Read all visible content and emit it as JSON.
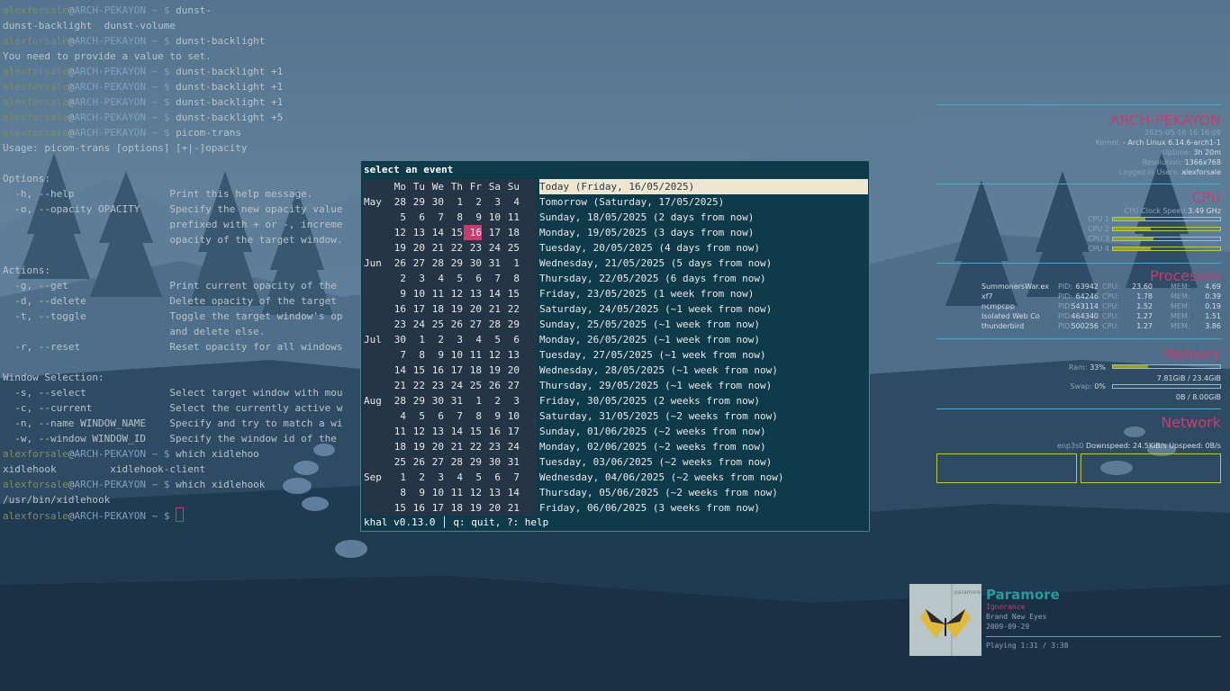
{
  "terminal": {
    "user": "alexforsale",
    "host": "ARCH-PEKAYON",
    "path": "~",
    "prompt": "$",
    "lines": [
      {
        "type": "prompt",
        "cmd": "dunst-"
      },
      {
        "type": "out",
        "text": "dunst-backlight  dunst-volume"
      },
      {
        "type": "prompt",
        "cmd": "dunst-backlight"
      },
      {
        "type": "out",
        "text": "You need to provide a value to set."
      },
      {
        "type": "prompt",
        "cmd": "dunst-backlight +1"
      },
      {
        "type": "prompt",
        "cmd": "dunst-backlight +1"
      },
      {
        "type": "prompt",
        "cmd": "dunst-backlight +1"
      },
      {
        "type": "prompt",
        "cmd": "dunst-backlight +5"
      },
      {
        "type": "prompt",
        "cmd": "picom-trans"
      },
      {
        "type": "out",
        "text": "Usage: picom-trans [options] [+|-]opacity"
      },
      {
        "type": "out",
        "text": ""
      },
      {
        "type": "out",
        "text": "Options:"
      },
      {
        "type": "out",
        "text": "  -h, --help                Print this help message."
      },
      {
        "type": "out",
        "text": "  -o, --opacity OPACITY     Specify the new opacity value"
      },
      {
        "type": "out",
        "text": "                            prefixed with + or -, increme"
      },
      {
        "type": "out",
        "text": "                            opacity of the target window."
      },
      {
        "type": "out",
        "text": ""
      },
      {
        "type": "out",
        "text": "Actions:"
      },
      {
        "type": "out",
        "text": "  -g, --get                 Print current opacity of the"
      },
      {
        "type": "out",
        "text": "  -d, --delete              Delete opacity of the target"
      },
      {
        "type": "out",
        "text": "  -t, --toggle              Toggle the target window's op"
      },
      {
        "type": "out",
        "text": "                            and delete else."
      },
      {
        "type": "out",
        "text": "  -r, --reset               Reset opacity for all windows"
      },
      {
        "type": "out",
        "text": ""
      },
      {
        "type": "out",
        "text": "Window Selection:"
      },
      {
        "type": "out",
        "text": "  -s, --select              Select target window with mou"
      },
      {
        "type": "out",
        "text": "  -c, --current             Select the currently active w"
      },
      {
        "type": "out",
        "text": "  -n, --name WINDOW_NAME    Specify and try to match a wi"
      },
      {
        "type": "out",
        "text": "  -w, --window WINDOW_ID    Specify the window id of the"
      },
      {
        "type": "prompt",
        "cmd": "which xidlehoo"
      },
      {
        "type": "out",
        "text": "xidlehook         xidlehook-client"
      },
      {
        "type": "prompt",
        "cmd": "which xidlehook"
      },
      {
        "type": "out",
        "text": "/usr/bin/xidlehook"
      },
      {
        "type": "prompt",
        "cmd": "",
        "cursor": true
      }
    ]
  },
  "khal": {
    "title": "select an event",
    "weekdays": [
      "Mo",
      "Tu",
      "We",
      "Th",
      "Fr",
      "Sa",
      "Su"
    ],
    "weeks": [
      {
        "month": "May",
        "days": [
          "28",
          "29",
          "30",
          "1",
          "2",
          "3",
          "4"
        ]
      },
      {
        "month": "",
        "days": [
          "5",
          "6",
          "7",
          "8",
          "9",
          "10",
          "11"
        ]
      },
      {
        "month": "",
        "days": [
          "12",
          "13",
          "14",
          "15",
          "16",
          "17",
          "18"
        ],
        "today_index": 4
      },
      {
        "month": "",
        "days": [
          "19",
          "20",
          "21",
          "22",
          "23",
          "24",
          "25"
        ]
      },
      {
        "month": "Jun",
        "days": [
          "26",
          "27",
          "28",
          "29",
          "30",
          "31",
          "1"
        ]
      },
      {
        "month": "",
        "days": [
          "2",
          "3",
          "4",
          "5",
          "6",
          "7",
          "8"
        ]
      },
      {
        "month": "",
        "days": [
          "9",
          "10",
          "11",
          "12",
          "13",
          "14",
          "15"
        ]
      },
      {
        "month": "",
        "days": [
          "16",
          "17",
          "18",
          "19",
          "20",
          "21",
          "22"
        ]
      },
      {
        "month": "",
        "days": [
          "23",
          "24",
          "25",
          "26",
          "27",
          "28",
          "29"
        ]
      },
      {
        "month": "Jul",
        "days": [
          "30",
          "1",
          "2",
          "3",
          "4",
          "5",
          "6"
        ]
      },
      {
        "month": "",
        "days": [
          "7",
          "8",
          "9",
          "10",
          "11",
          "12",
          "13"
        ]
      },
      {
        "month": "",
        "days": [
          "14",
          "15",
          "16",
          "17",
          "18",
          "19",
          "20"
        ]
      },
      {
        "month": "",
        "days": [
          "21",
          "22",
          "23",
          "24",
          "25",
          "26",
          "27"
        ]
      },
      {
        "month": "Aug",
        "days": [
          "28",
          "29",
          "30",
          "31",
          "1",
          "2",
          "3"
        ]
      },
      {
        "month": "",
        "days": [
          "4",
          "5",
          "6",
          "7",
          "8",
          "9",
          "10"
        ]
      },
      {
        "month": "",
        "days": [
          "11",
          "12",
          "13",
          "14",
          "15",
          "16",
          "17"
        ]
      },
      {
        "month": "",
        "days": [
          "18",
          "19",
          "20",
          "21",
          "22",
          "23",
          "24"
        ]
      },
      {
        "month": "",
        "days": [
          "25",
          "26",
          "27",
          "28",
          "29",
          "30",
          "31"
        ]
      },
      {
        "month": "Sep",
        "days": [
          "1",
          "2",
          "3",
          "4",
          "5",
          "6",
          "7"
        ]
      },
      {
        "month": "",
        "days": [
          "8",
          "9",
          "10",
          "11",
          "12",
          "13",
          "14"
        ]
      },
      {
        "month": "",
        "days": [
          "15",
          "16",
          "17",
          "18",
          "19",
          "20",
          "21"
        ]
      }
    ],
    "events": [
      "Today (Friday, 16/05/2025)",
      "Tomorrow (Saturday, 17/05/2025)",
      "Sunday, 18/05/2025 (2 days from now)",
      "Monday, 19/05/2025 (3 days from now)",
      "Tuesday, 20/05/2025 (4 days from now)",
      "Wednesday, 21/05/2025 (5 days from now)",
      "Thursday, 22/05/2025 (6 days from now)",
      "Friday, 23/05/2025 (1 week from now)",
      "Saturday, 24/05/2025 (~1 week from now)",
      "Sunday, 25/05/2025 (~1 week from now)",
      "Monday, 26/05/2025 (~1 week from now)",
      "Tuesday, 27/05/2025 (~1 week from now)",
      "Wednesday, 28/05/2025 (~1 week from now)",
      "Thursday, 29/05/2025 (~1 week from now)",
      "Friday, 30/05/2025 (2 weeks from now)",
      "Saturday, 31/05/2025 (~2 weeks from now)",
      "Sunday, 01/06/2025 (~2 weeks from now)",
      "Monday, 02/06/2025 (~2 weeks from now)",
      "Tuesday, 03/06/2025 (~2 weeks from now)",
      "Wednesday, 04/06/2025 (~2 weeks from now)",
      "Thursday, 05/06/2025 (~2 weeks from now)",
      "Friday, 06/06/2025 (3 weeks from now)"
    ],
    "selected_event_index": 0,
    "footer": "khal v0.13.0 │ q: quit, ?: help"
  },
  "conky": {
    "hostname": "ARCH-PEKAYON",
    "datetime": "2025-05-16 16:16:09",
    "kernel_label": "Kernel:",
    "kernel": "Arch Linux 6.14.6-arch1-1",
    "uptime_label": "Uptime:",
    "uptime": "3h 20m",
    "resolution_label": "Resolution:",
    "resolution": "1366x768",
    "users_label": "Logged in Users:",
    "users": "alexforsale",
    "cpu": {
      "title": "CPU",
      "clock_label": "CPU Clock Speed:",
      "clock": "3.49 GHz",
      "cores": [
        {
          "label": "CPU 1",
          "usage": 0.3
        },
        {
          "label": "CPU 2",
          "usage": 0.35
        },
        {
          "label": "CPU 3",
          "usage": 0.38
        },
        {
          "label": "CPU 4",
          "usage": 0.35
        }
      ]
    },
    "processes": {
      "title": "Processes",
      "pid_label": "PID:",
      "cpu_label": "CPU:",
      "mem_label": "MEM:",
      "rows": [
        {
          "name": "SummonersWar.ex",
          "pid": "63942",
          "cpu": "23.60",
          "mem": "4.69"
        },
        {
          "name": "xf7",
          "pid": "64246",
          "cpu": "1.78",
          "mem": "0.39"
        },
        {
          "name": "ncmpcpp",
          "pid": "543114",
          "cpu": "1.52",
          "mem": "0.19"
        },
        {
          "name": "Isolated Web Co",
          "pid": "464340",
          "cpu": "1.27",
          "mem": "1.51"
        },
        {
          "name": "thunderbird",
          "pid": "500256",
          "cpu": "1.27",
          "mem": "3.86"
        }
      ]
    },
    "memory": {
      "title": "Memory",
      "ram_label": "Ram:",
      "ram_pct": "33%",
      "ram_usage": 0.33,
      "ram_text": "7.81GiB / 23.4GiB",
      "swap_label": "Swap:",
      "swap_pct": "0%",
      "swap_usage": 0.0,
      "swap_text": "0B / 8.00GiB"
    },
    "network": {
      "title": "Network",
      "iface": "enp3s0",
      "down_label": "Downspeed:",
      "down": "24.5KiB/s",
      "up_label": "Upspeed:",
      "up": "0B/s"
    }
  },
  "music": {
    "artist": "Paramore",
    "song": "Ignorance",
    "album": "Brand New Eyes",
    "date": "2009-09-29",
    "cover_text": "paramore",
    "status": "Playing 1:31 / 3:38"
  },
  "colors": {
    "accent": "#c04070",
    "bar": "#b7c84a",
    "khal_bg": "#0e3a4a",
    "teal": "#2a9aa0"
  }
}
